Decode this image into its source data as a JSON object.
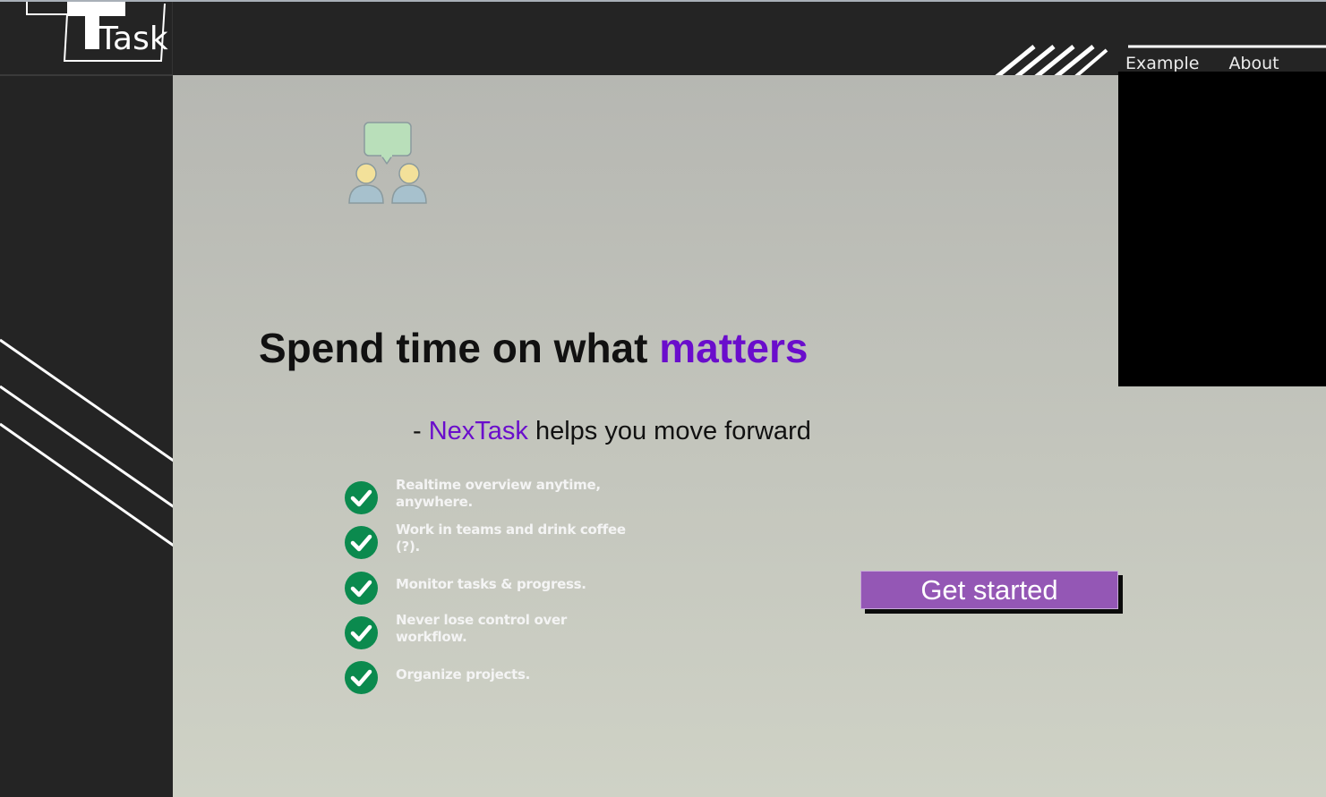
{
  "logo": {
    "text": "Task"
  },
  "nav": {
    "items": [
      {
        "label": "Example"
      },
      {
        "label": "About"
      }
    ]
  },
  "hero": {
    "headline_main": "Spend time on what ",
    "headline_accent": "matters",
    "sub_prefix": "- ",
    "sub_brand": "NexTask",
    "sub_rest": " helps you move forward"
  },
  "features": [
    {
      "text": "Realtime overview anytime, anywhere."
    },
    {
      "text": "Work in teams and drink coffee (?)."
    },
    {
      "text": "Monitor tasks & progress."
    },
    {
      "text": "Never lose control over workflow."
    },
    {
      "text": "Organize projects."
    }
  ],
  "cta": {
    "label": "Get started"
  },
  "icons": {
    "team": "team-chat-icon",
    "check": "check-circle-icon"
  },
  "colors": {
    "accent": "#6a0dcc",
    "cta_bg": "#9457b5",
    "check_green": "#0b8a4e",
    "dark_bg": "#242424"
  }
}
